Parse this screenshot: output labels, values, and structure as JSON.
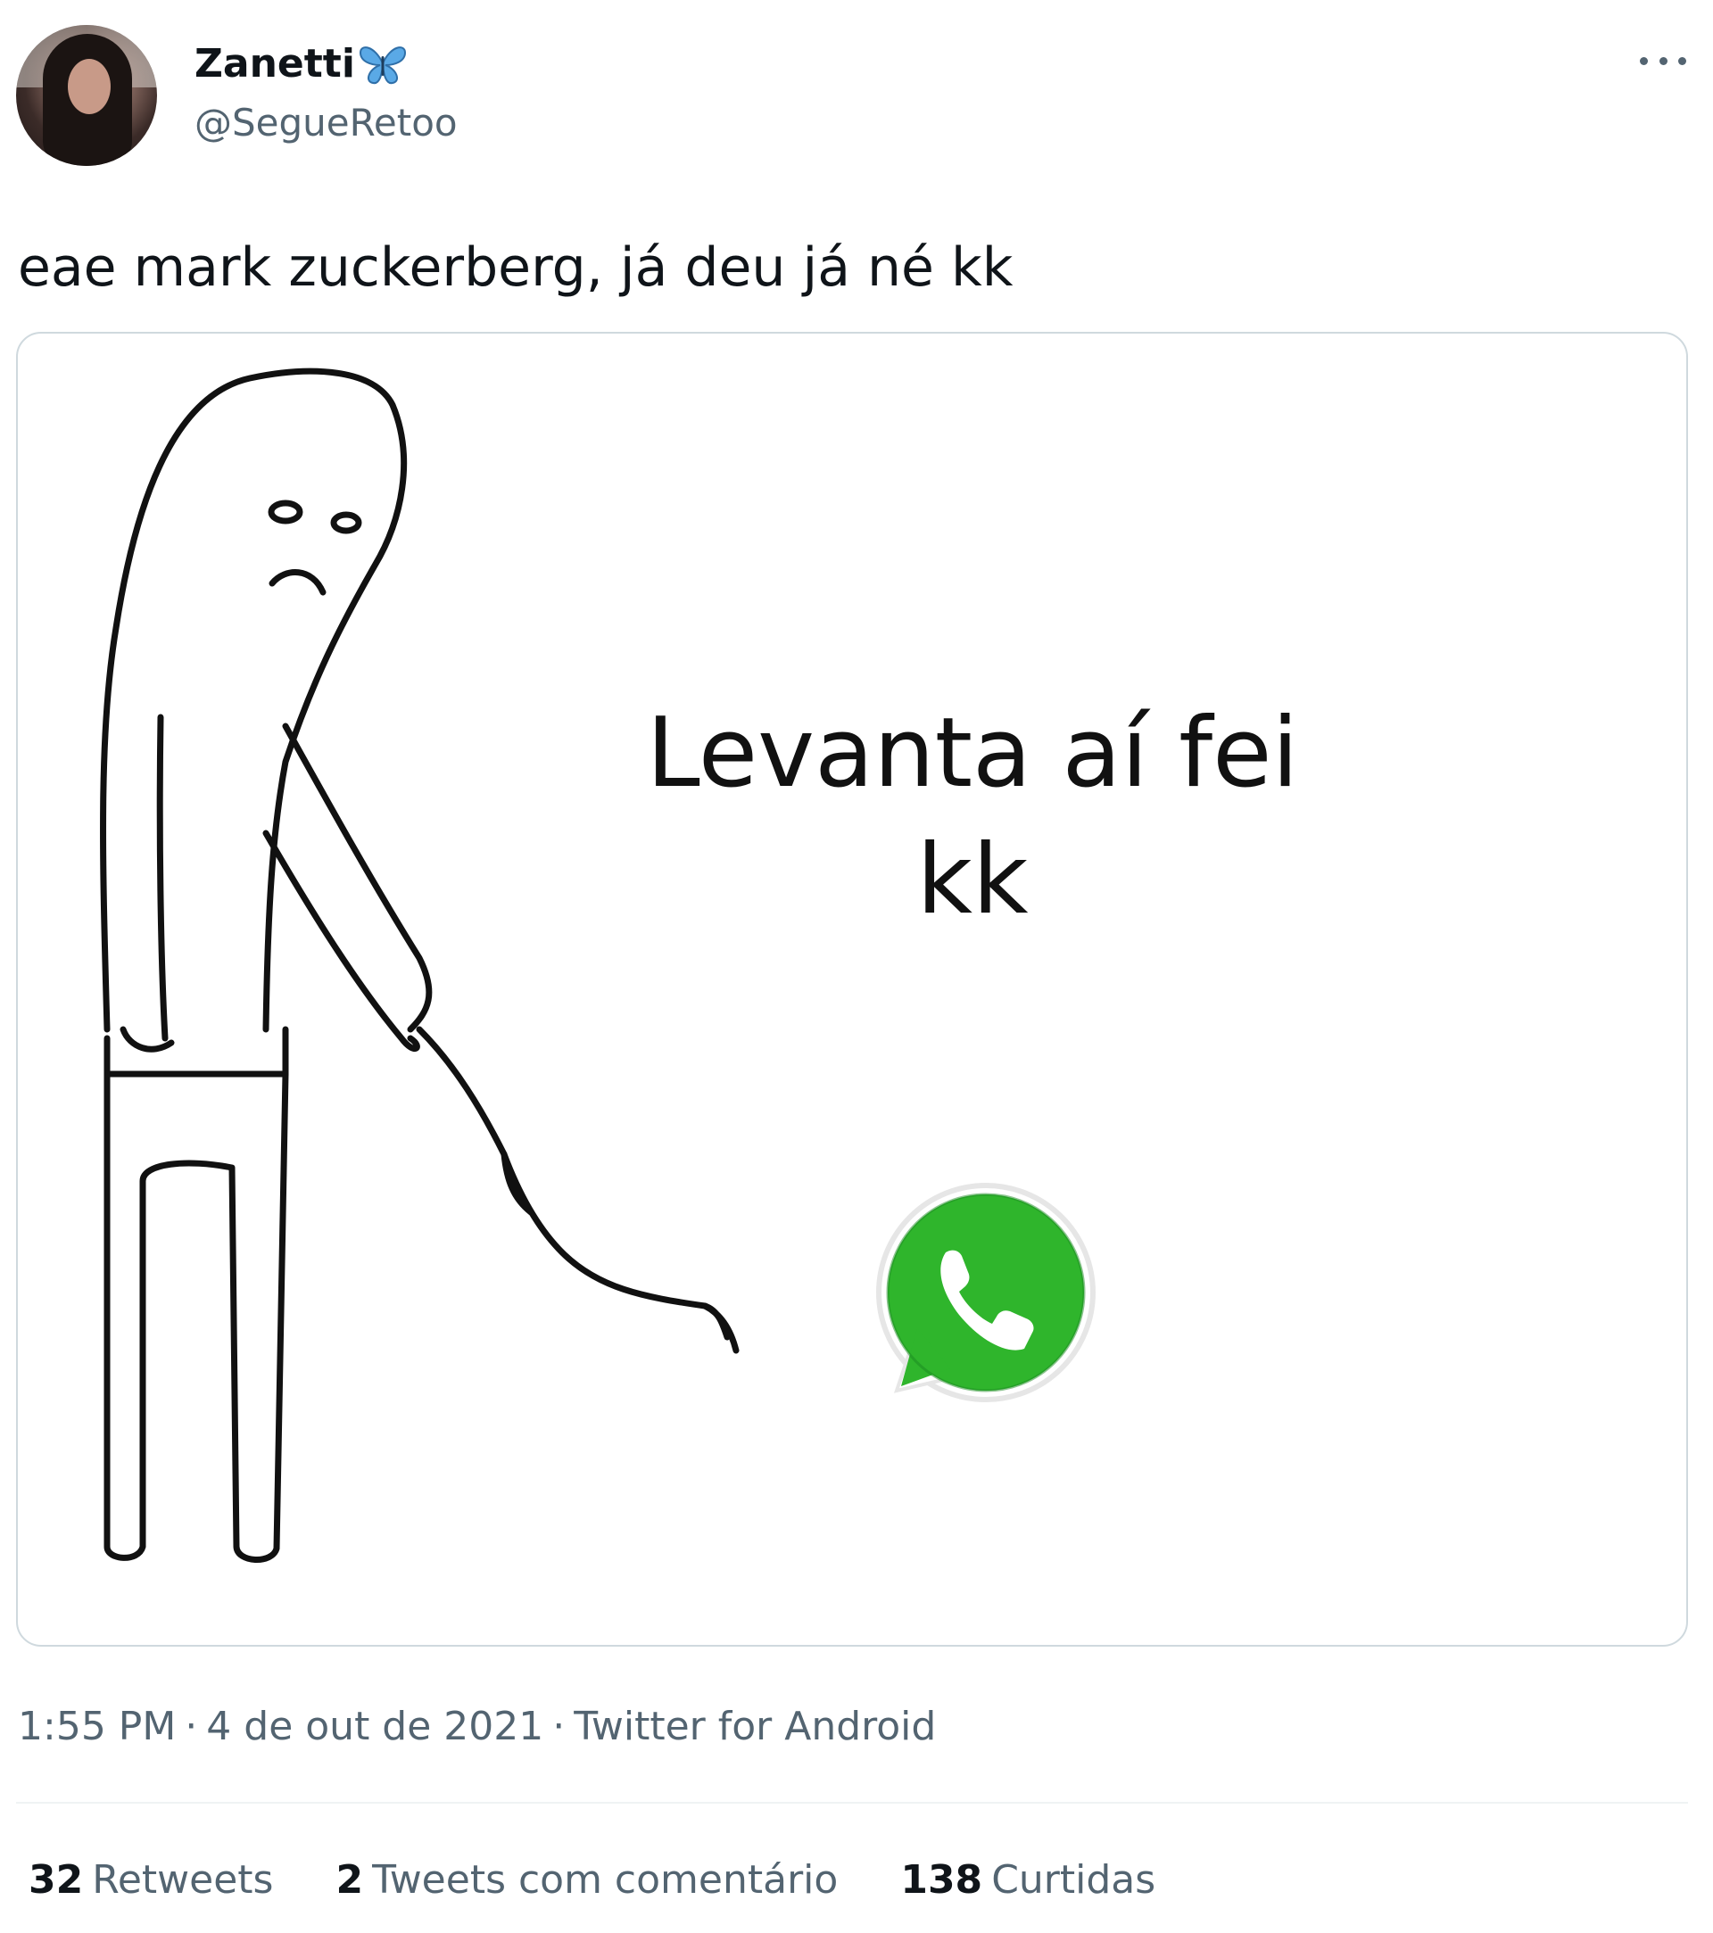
{
  "author": {
    "display_name": "Zanetti",
    "handle": "@SegueRetoo",
    "badge_icon": "butterfly-icon"
  },
  "tweet": {
    "text": "eae mark zuckerberg, já deu já né kk"
  },
  "media": {
    "caption_line1": "Levanta aí fei",
    "caption_line2": "kk",
    "logo": "whatsapp-icon",
    "colors": {
      "whatsapp_green": "#2fb52c",
      "whatsapp_dark": "#1a8a1f"
    }
  },
  "meta": {
    "time": "1:55 PM",
    "date": "4 de out de 2021",
    "source": "Twitter for Android",
    "separator": "·"
  },
  "stats": {
    "retweets_count": "32",
    "retweets_label": "Retweets",
    "quotes_count": "2",
    "quotes_label": "Tweets com comentário",
    "likes_count": "138",
    "likes_label": "Curtidas"
  },
  "colors": {
    "text_primary": "#0f1419",
    "text_secondary": "#536471",
    "border": "#cfd9de"
  }
}
